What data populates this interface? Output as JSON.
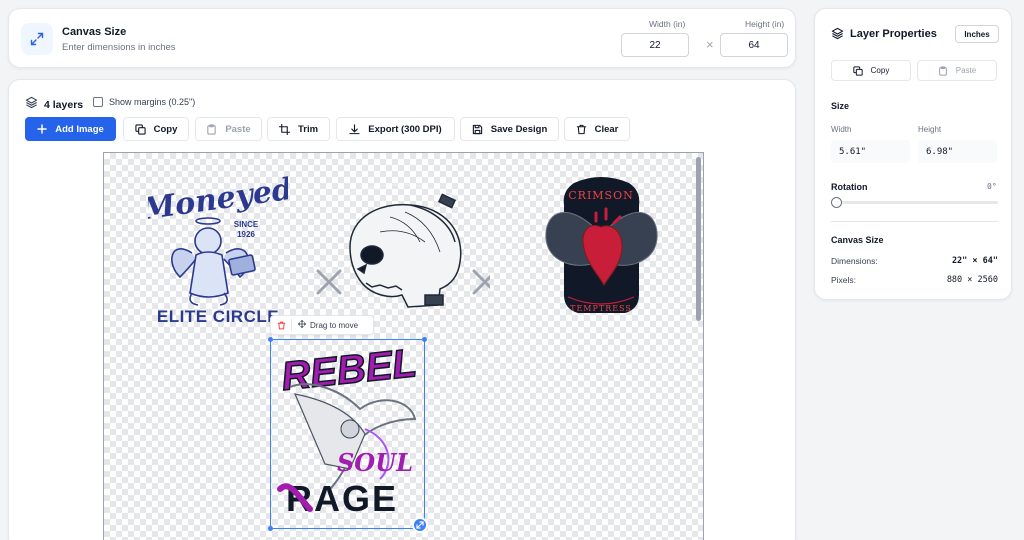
{
  "canvas_size": {
    "title": "Canvas Size",
    "subtitle": "Enter dimensions in inches",
    "width_label": "Width (in)",
    "height_label": "Height (in)",
    "width_value": "22",
    "height_value": "64",
    "times_glyph": "×"
  },
  "editor": {
    "layers_count": "4 layers",
    "show_margins_label": "Show margins (0.25\")",
    "show_margins_checked": false,
    "toolbar": {
      "add_image": "Add Image",
      "copy": "Copy",
      "paste": "Paste",
      "trim": "Trim",
      "export": "Export (300 DPI)",
      "save_design": "Save Design",
      "clear": "Clear"
    },
    "drag_hint": "Drag to move",
    "designs": {
      "angel": {
        "line1": "Moneyed",
        "since": "SINCE",
        "year": "1926",
        "bottom": "ELITE CIRCLE",
        "color": "#2b3a8f"
      },
      "skull": {
        "color": "#1f2937"
      },
      "heart": {
        "top": "CRIMSON",
        "bottom": "TEMPTRESS",
        "accent": "#c81e3a"
      },
      "rebel": {
        "top": "REBEL",
        "mid": "SOUL",
        "bottom": "RAGE",
        "accent": "#a21caf"
      }
    }
  },
  "layer_properties": {
    "title": "Layer Properties",
    "unit_button": "Inches",
    "copy": "Copy",
    "paste": "Paste",
    "size_heading": "Size",
    "width_label": "Width",
    "height_label": "Height",
    "width_value": "5.61\"",
    "height_value": "6.98\"",
    "rotation_label": "Rotation",
    "rotation_value": "0°",
    "rotation_degrees": 0,
    "canvas_heading": "Canvas Size",
    "dimensions_label": "Dimensions:",
    "dimensions_value": "22\" × 64\"",
    "pixels_label": "Pixels:",
    "pixels_value": "880 × 2560"
  },
  "colors": {
    "primary": "#2563eb",
    "selection": "#3b82f6",
    "danger": "#ef4444"
  }
}
